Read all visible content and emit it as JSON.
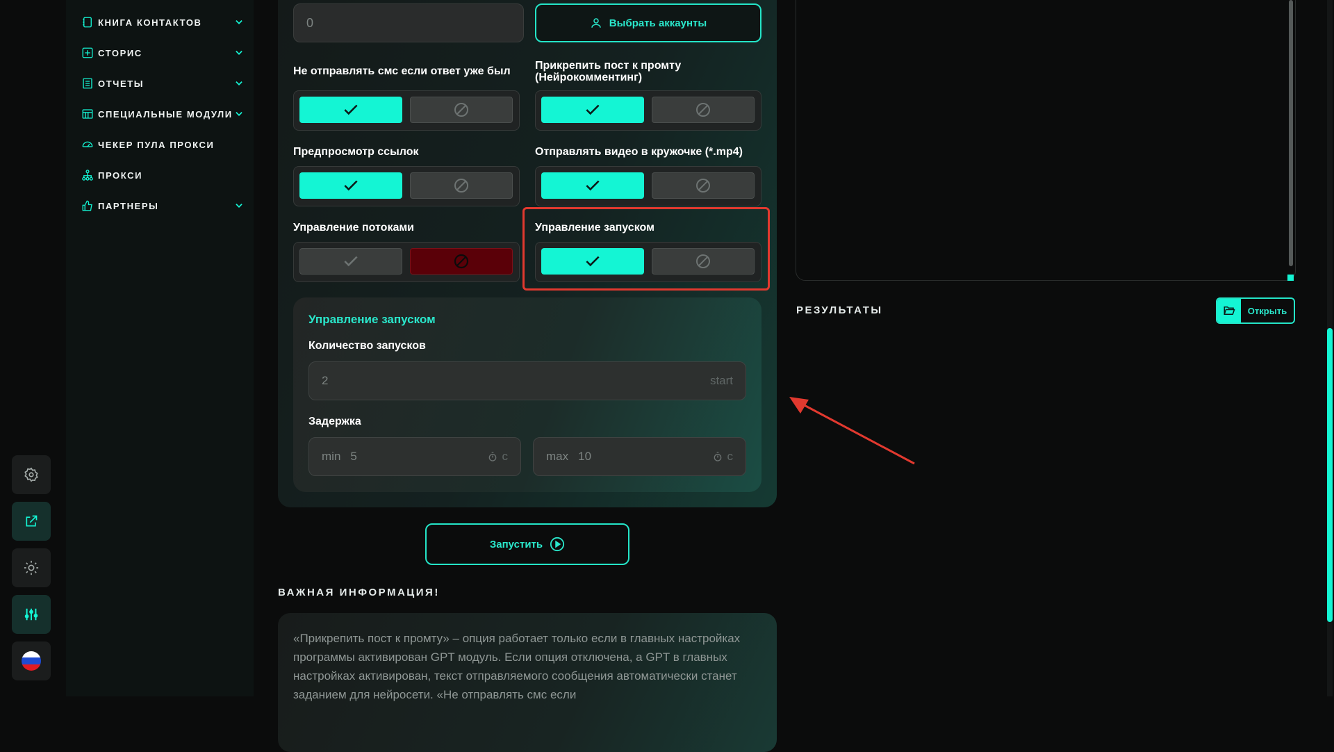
{
  "sidebar": {
    "items": [
      {
        "label": "КНИГА КОНТАКТОВ",
        "icon": "contacts-book-icon",
        "expandable": true
      },
      {
        "label": "СТОРИС",
        "icon": "plus-square-icon",
        "expandable": true
      },
      {
        "label": "ОТЧЕТЫ",
        "icon": "report-icon",
        "expandable": true
      },
      {
        "label": "СПЕЦИАЛЬНЫЕ МОДУЛИ",
        "icon": "modules-icon",
        "expandable": true
      },
      {
        "label": "ЧЕКЕР ПУЛА ПРОКСИ",
        "icon": "gauge-icon",
        "expandable": false
      },
      {
        "label": "ПРОКСИ",
        "icon": "network-icon",
        "expandable": false
      },
      {
        "label": "ПАРТНЕРЫ",
        "icon": "thumbs-up-icon",
        "expandable": true
      }
    ]
  },
  "rail": [
    "gear-icon",
    "external-link-icon",
    "sun-icon",
    "sliders-icon",
    "russia-flag-icon"
  ],
  "top": {
    "count_value": "0",
    "select_accounts_label": "Выбрать аккаунты"
  },
  "options": [
    {
      "label": "Не отправлять смс если ответ уже был",
      "state": "on"
    },
    {
      "label": "Прикрепить пост к промту (Нейрокомментинг)",
      "state": "on"
    },
    {
      "label": "Предпросмотр ссылок",
      "state": "on"
    },
    {
      "label": "Отправлять видео в кружочке (*.mp4)",
      "state": "on"
    },
    {
      "label": "Управление потоками",
      "state": "off"
    },
    {
      "label": "Управление запуском",
      "state": "on"
    }
  ],
  "launch_control": {
    "title": "Управление запуском",
    "runs_label": "Количество запусков",
    "runs_value": "2",
    "runs_suffix": "start",
    "delay_label": "Задержка",
    "min_prefix": "min",
    "min_value": "5",
    "max_prefix": "max",
    "max_value": "10",
    "unit": "с"
  },
  "launch_button": "Запустить",
  "info": {
    "heading": "ВАЖНАЯ ИНФОРМАЦИЯ!",
    "text": "«Прикрепить пост к промту» – опция работает только если в главных настройках программы активирован GPT модуль. Если опция отключена, а GPT в главных настройках активирован, текст отправляемого сообщения автоматически станет заданием для нейросети. «Не отправлять смс если"
  },
  "results": {
    "heading": "РЕЗУЛЬТАТЫ",
    "open_label": "Открыть"
  },
  "colors": {
    "accent": "#14f5d4",
    "highlight": "#e2392f",
    "off_red": "#5a0008"
  }
}
